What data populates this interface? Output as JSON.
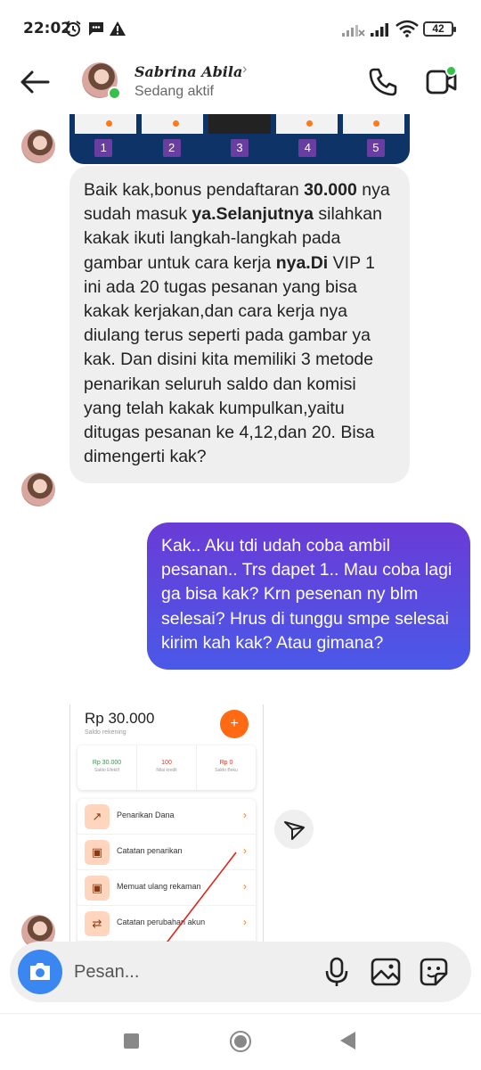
{
  "status_bar": {
    "time": "22:02",
    "battery": "42"
  },
  "header": {
    "contact_name": "Sabrina Abila",
    "contact_status": "Sedang aktif"
  },
  "messages": {
    "image_strip_numbers": [
      "1",
      "2",
      "3",
      "4",
      "5"
    ],
    "incoming_text_parts": [
      "Baik kak,bonus pendaftaran ",
      "30.000",
      " nya sudah masuk ",
      "ya.Selanjutnya",
      " silahkan kakak ikuti langkah-langkah pada gambar untuk cara kerja ",
      "nya.Di",
      " VIP 1 ini ada 20 tugas pesanan yang bisa kakak kerjakan,dan cara kerja nya diulang terus seperti pada gambar ya kak. Dan disini kita memiliki 3 metode penarikan seluruh saldo dan komisi yang telah kakak kumpulkan,yaitu ditugas pesanan ke 4,12,dan 20. Bisa dimengerti kak?"
    ],
    "outgoing_text": "Kak.. Aku tdi udah coba ambil pesanan.. Trs dapet 1.. Mau coba lagi ga bisa kak? Krn pesenan ny blm selesai? Hrus di tunggu smpe selesai kirim kah kak? Atau gimana?"
  },
  "screenshot": {
    "balance": "Rp 30.000",
    "balance_label": "Saldo rekening",
    "plus_label": "+",
    "stats": [
      {
        "value": "Rp 30.000",
        "label": "Saldo Efektif",
        "color": "#2e9d3a"
      },
      {
        "value": "100",
        "label": "Nilai kredit",
        "color": "#d23a2a"
      },
      {
        "value": "Rp 0",
        "label": "Saldo Beku",
        "color": "#d23a2a"
      }
    ],
    "menu": [
      {
        "label": "Penarikan Dana",
        "icon": "arrow-up-right-icon"
      },
      {
        "label": "Catatan penarikan",
        "icon": "wallet-icon"
      },
      {
        "label": "Memuat ulang rekaman",
        "icon": "wallet-icon"
      },
      {
        "label": "Catatan perubahan akun",
        "icon": "swap-icon"
      }
    ]
  },
  "input_bar": {
    "placeholder": "Pesan..."
  },
  "colors": {
    "outgoing_gradient_top": "#6a3bd6",
    "outgoing_gradient_bottom": "#4a59e8",
    "camera_button": "#3a87f2",
    "online": "#35c24a"
  }
}
